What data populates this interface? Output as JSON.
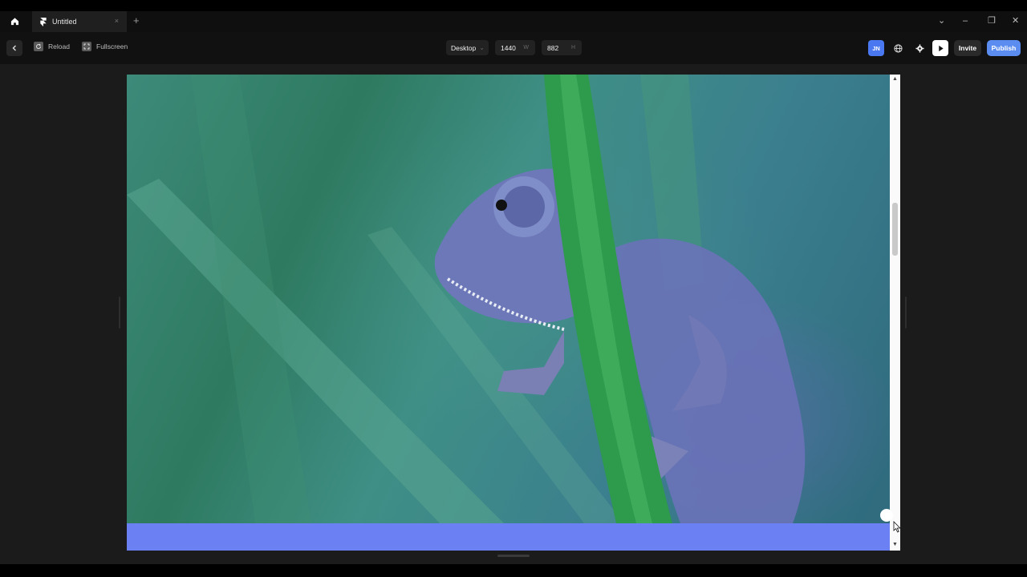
{
  "tab": {
    "title": "Untitled",
    "close": "×",
    "new": "+"
  },
  "window": {
    "dropdown": "⌄",
    "minimize": "–",
    "restore": "❐",
    "close": "✕"
  },
  "toolbar": {
    "reload_label": "Reload",
    "fullscreen_label": "Fullscreen",
    "device": {
      "value": "Desktop",
      "chevron": "⌄"
    },
    "width": {
      "value": "1440",
      "suffix": "W"
    },
    "height": {
      "value": "882",
      "suffix": "H"
    },
    "avatar_initials": "JN",
    "invite_label": "Invite",
    "publish_label": "Publish"
  },
  "canvas": {
    "image_subject": "chameleon on green stem",
    "banner_color": "#6b80f3",
    "scroll_up": "▲",
    "scroll_down": "▼"
  },
  "colors": {
    "accent": "#5b8df0",
    "avatar": "#4a78f0"
  }
}
